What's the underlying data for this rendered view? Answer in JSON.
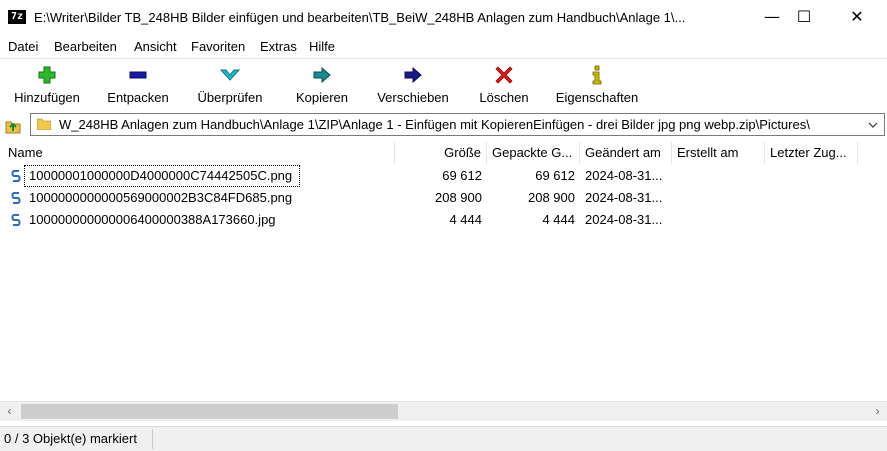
{
  "window": {
    "app_icon_text": "7z",
    "title": "E:\\Writer\\Bilder TB_248HB Bilder einfügen und bearbeiten\\TB_BeiW_248HB Anlagen zum Handbuch\\Anlage 1\\...",
    "minimize": "—",
    "maximize": "☐",
    "close": "✕"
  },
  "menu": [
    "Datei",
    "Bearbeiten",
    "Ansicht",
    "Favoriten",
    "Extras",
    "Hilfe"
  ],
  "toolbar": {
    "add": "Hinzufügen",
    "extract": "Entpacken",
    "test": "Überprüfen",
    "copy": "Kopieren",
    "move": "Verschieben",
    "delete": "Löschen",
    "info": "Eigenschaften",
    "colors": {
      "add": "#2db82d",
      "extract": "#1a1aa6",
      "test": "#22b8c8",
      "copy": "#1a8a8a",
      "move": "#1a1a8a",
      "delete": "#e01b1b",
      "info": "#c9b800"
    }
  },
  "address": {
    "path": "W_248HB Anlagen zum Handbuch\\Anlage 1\\ZIP\\Anlage 1 - Einfügen mit KopierenEinfügen - drei Bilder jpg png webp.zip\\Pictures\\"
  },
  "columns": {
    "name": "Name",
    "size": "Größe",
    "packed": "Gepackte G...",
    "modified": "Geändert am",
    "created": "Erstellt am",
    "accessed": "Letzter Zug..."
  },
  "files": [
    {
      "name": "10000001000000D4000000C74442505C.png",
      "size": "69 612",
      "packed": "69 612",
      "modified": "2024-08-31..."
    },
    {
      "name": "1000000000000569000002B3C84FD685.png",
      "size": "208 900",
      "packed": "208 900",
      "modified": "2024-08-31..."
    },
    {
      "name": "100000000000006400000388A173660.jpg",
      "size": "4 444",
      "packed": "4 444",
      "modified": "2024-08-31..."
    }
  ],
  "scrollbar": {
    "left_arrow": "‹",
    "right_arrow": "›"
  },
  "status": {
    "selection": "0 / 3 Objekt(e) markiert"
  }
}
